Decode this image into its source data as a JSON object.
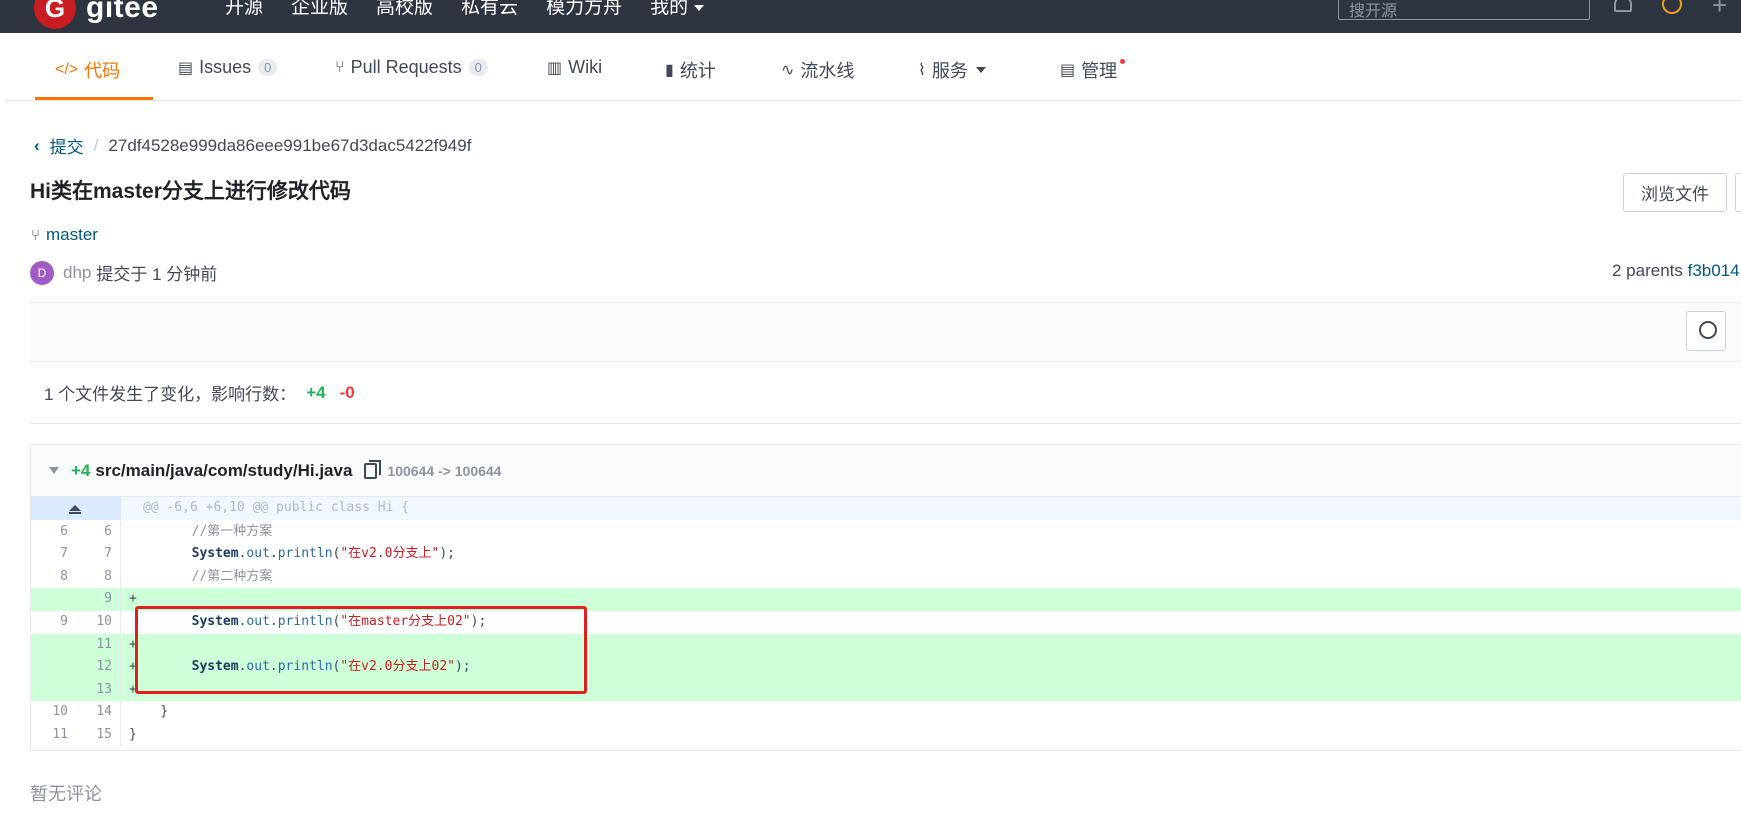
{
  "topbar": {
    "logo_letter": "G",
    "logo_text": "gitee",
    "nav": [
      "开源",
      "企业版",
      "高校版",
      "私有云",
      "模力方舟",
      "我的"
    ],
    "search_placeholder": "搜开源"
  },
  "tabs": [
    {
      "label": "代码",
      "icon": "code-icon"
    },
    {
      "label": "Issues",
      "count": "0",
      "icon": "issues-icon"
    },
    {
      "label": "Pull Requests",
      "count": "0",
      "icon": "pull-request-icon"
    },
    {
      "label": "Wiki",
      "icon": "wiki-icon"
    },
    {
      "label": "统计",
      "icon": "stats-icon"
    },
    {
      "label": "流水线",
      "icon": "pipeline-icon"
    },
    {
      "label": "服务",
      "icon": "service-icon"
    },
    {
      "label": "管理",
      "icon": "manage-icon"
    }
  ],
  "breadcrumb": {
    "parent": "提交",
    "separator": "/",
    "current": "27df4528e999da86eee991be67d3dac5422f949f"
  },
  "commit": {
    "title": "Hi类在master分支上进行修改代码",
    "branch": "master",
    "avatar_letter": "D",
    "author": "dhp",
    "committed": "提交于 1 分钟前",
    "parents_label": "2 parents",
    "parent_sha": "f3b014",
    "browse_button": "浏览文件"
  },
  "stats": {
    "summary": "1 个文件发生了变化，影响行数：",
    "additions": "+4",
    "deletions": "-0"
  },
  "file": {
    "additions": "+4",
    "path": "src/main/java/com/study/Hi.java",
    "mode": "100644 -> 100644",
    "hunk": "@@ -6,6 +6,10 @@ public class Hi {",
    "lines": [
      {
        "old": "6",
        "new": "6",
        "type": "context",
        "text": "        //第一种方案"
      },
      {
        "old": "7",
        "new": "7",
        "type": "context",
        "text": "        System.out.println(\"在v2.0分支上\");"
      },
      {
        "old": "8",
        "new": "8",
        "type": "context",
        "text": "        //第二种方案"
      },
      {
        "old": "",
        "new": "9",
        "type": "added",
        "text": "+"
      },
      {
        "old": "9",
        "new": "10",
        "type": "context",
        "text": "        System.out.println(\"在master分支上02\");"
      },
      {
        "old": "",
        "new": "11",
        "type": "added",
        "text": "+"
      },
      {
        "old": "",
        "new": "12",
        "type": "added",
        "text": "+       System.out.println(\"在v2.0分支上02\");"
      },
      {
        "old": "",
        "new": "13",
        "type": "added",
        "text": "+"
      },
      {
        "old": "10",
        "new": "14",
        "type": "context",
        "text": "    }"
      },
      {
        "old": "11",
        "new": "15",
        "type": "context",
        "text": "}"
      }
    ]
  },
  "comments": {
    "empty_text": "暂无评论"
  },
  "colors": {
    "accent": "#fe7300",
    "link": "#005980",
    "added_bg": "#cdffd8",
    "highlight_border": "#e02020"
  }
}
